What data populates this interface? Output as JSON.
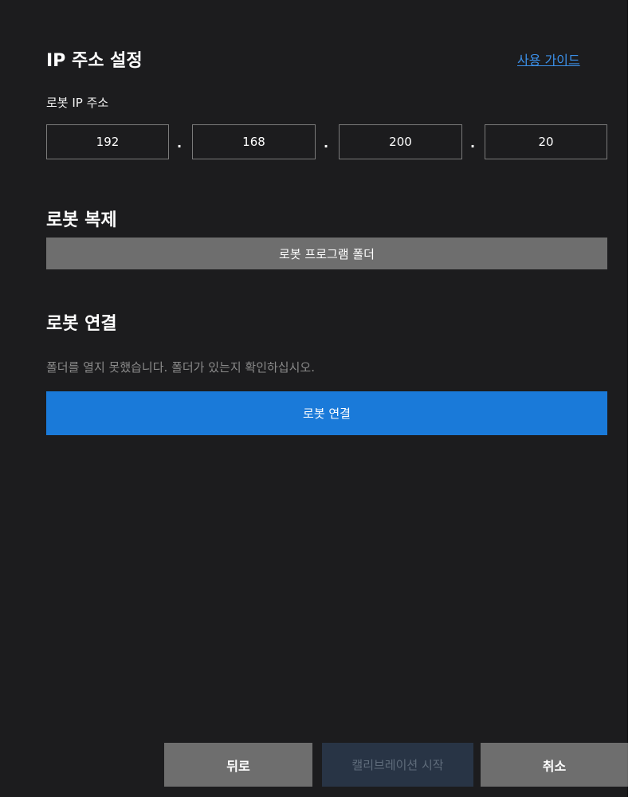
{
  "ip_section": {
    "title": "IP 주소 설정",
    "guide_link": "사용 가이드",
    "robot_ip_label": "로봇 IP 주소",
    "octets": [
      "192",
      "168",
      "200",
      "20"
    ],
    "separator": "."
  },
  "clone_section": {
    "title": "로봇 복제",
    "folder_button": "로봇 프로그램 폴더"
  },
  "connect_section": {
    "title": "로봇 연결",
    "status": "폴더를 열지 못했습니다. 폴더가 있는지 확인하십시오.",
    "connect_button": "로봇 연결"
  },
  "footer": {
    "back_button": "뒤로",
    "start_button": "캘리브레이션 시작",
    "cancel_button": "취소"
  },
  "colors": {
    "background": "#1c1c1e",
    "accent": "#1a7ad9",
    "link": "#3b8fe8",
    "button_gray": "#6e6e6e",
    "disabled_button": "#283445"
  }
}
